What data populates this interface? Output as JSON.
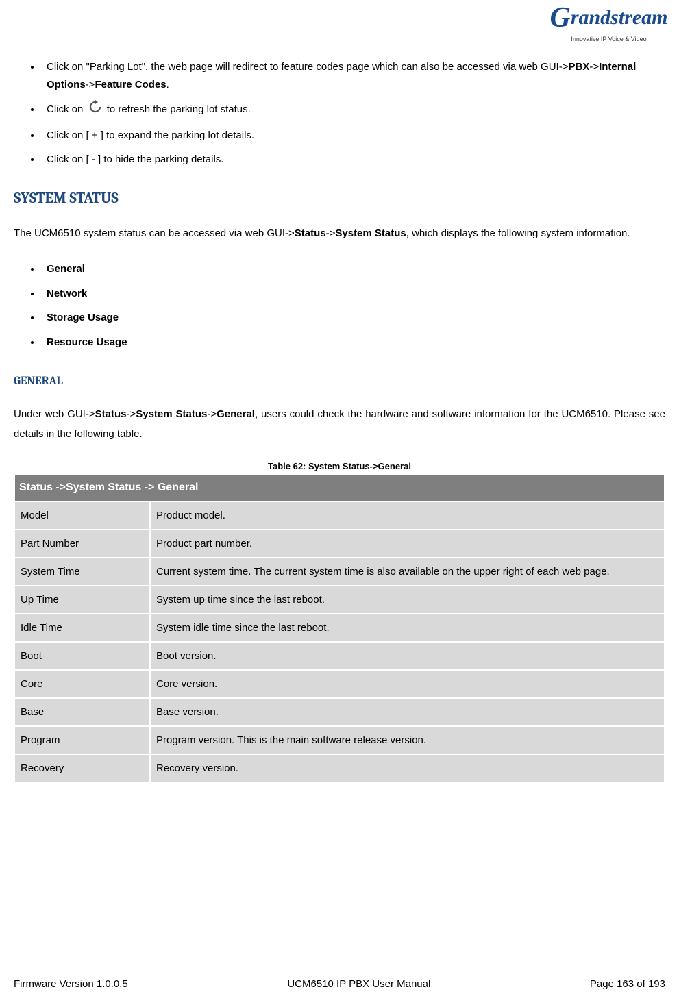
{
  "logo": {
    "brand": "Grandstream",
    "tag": "Innovative IP Voice & Video"
  },
  "bullets1": {
    "b1_pre": "Click on \"Parking Lot\", the web page will redirect to feature codes page which can also be accessed via web GUI->",
    "b1_path1": "PBX",
    "b1_sep1": "->",
    "b1_path2": "Internal Options",
    "b1_sep2": "->",
    "b1_path3": "Feature Codes",
    "b1_end": ".",
    "b2_pre": "Click on ",
    "b2_post": " to refresh the parking lot status.",
    "b3": "Click on [ + ] to expand the parking lot details.",
    "b4": "Click on [ - ] to hide the parking details."
  },
  "section_title": "SYSTEM STATUS",
  "section_intro_pre": "The UCM6510 system status can be accessed via web GUI->",
  "section_intro_b1": "Status",
  "section_intro_sep1": "->",
  "section_intro_b2": "System Status",
  "section_intro_post": ", which displays the following system information.",
  "info_list": {
    "i1": "General",
    "i2": "Network",
    "i3": "Storage Usage",
    "i4": "Resource Usage"
  },
  "subsection_title": "GENERAL",
  "sub_intro_1": "Under  web  GUI->",
  "sub_intro_b1": "Status",
  "sub_intro_s1": "->",
  "sub_intro_b2": "System  Status",
  "sub_intro_s2": "->",
  "sub_intro_b3": "General",
  "sub_intro_2a": ",  users  could  check  the  hardware  and  software",
  "sub_intro_2b": "information for the UCM6510. Please see details in the following table.",
  "table_caption": "Table 62: System Status->General",
  "table": {
    "header": "Status ->System Status -> General",
    "rows": [
      {
        "label": "Model",
        "desc": "Product model."
      },
      {
        "label": "Part Number",
        "desc": "Product part number."
      },
      {
        "label": "System Time",
        "desc": "Current system time. The current system time is also available on the upper right of each web page."
      },
      {
        "label": "Up Time",
        "desc": "System up time since the last reboot."
      },
      {
        "label": "Idle Time",
        "desc": "System idle time since the last reboot."
      },
      {
        "label": "Boot",
        "desc": "Boot version."
      },
      {
        "label": "Core",
        "desc": "Core version."
      },
      {
        "label": "Base",
        "desc": "Base version."
      },
      {
        "label": "Program",
        "desc": "Program version. This is the main software release version."
      },
      {
        "label": "Recovery",
        "desc": "Recovery version."
      }
    ]
  },
  "footer": {
    "left": "Firmware Version 1.0.0.5",
    "center": "UCM6510 IP PBX User Manual",
    "right": "Page 163 of 193"
  }
}
